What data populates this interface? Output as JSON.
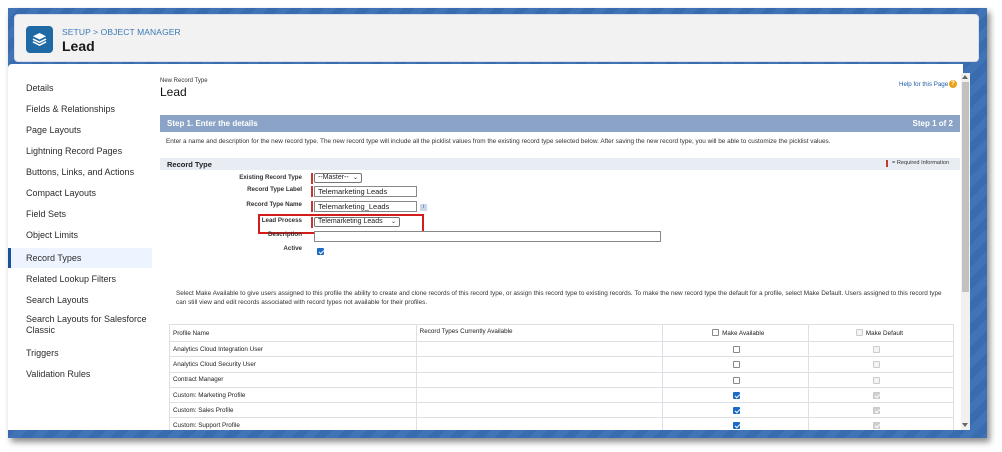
{
  "header": {
    "breadcrumb": "SETUP > OBJECT MANAGER",
    "title": "Lead",
    "icon": "layers-icon"
  },
  "sidebar": {
    "items": [
      {
        "label": "Details",
        "active": false
      },
      {
        "label": "Fields & Relationships",
        "active": false
      },
      {
        "label": "Page Layouts",
        "active": false
      },
      {
        "label": "Lightning Record Pages",
        "active": false
      },
      {
        "label": "Buttons, Links, and Actions",
        "active": false
      },
      {
        "label": "Compact Layouts",
        "active": false
      },
      {
        "label": "Field Sets",
        "active": false
      },
      {
        "label": "Object Limits",
        "active": false
      },
      {
        "label": "Record Types",
        "active": true
      },
      {
        "label": "Related Lookup Filters",
        "active": false
      },
      {
        "label": "Search Layouts",
        "active": false
      },
      {
        "label": "Search Layouts for Salesforce Classic",
        "active": false
      },
      {
        "label": "Triggers",
        "active": false
      },
      {
        "label": "Validation Rules",
        "active": false
      }
    ]
  },
  "page": {
    "subtitle": "New Record Type",
    "title": "Lead",
    "help_link": "Help for this Page",
    "step_title": "Step 1. Enter the details",
    "step_count": "Step 1 of 2",
    "intro": "Enter a name and description for the new record type. The new record type will include all the picklist values from the existing record type selected below. After saving the new record type, you will be able to customize the picklist values.",
    "section_title": "Record Type",
    "required_info": "= Required Information"
  },
  "form": {
    "existing_label": "Existing Record Type",
    "existing_value": "--Master--",
    "rt_label_label": "Record Type Label",
    "rt_label_value": "Telemarketing Leads",
    "rt_name_label": "Record Type Name",
    "rt_name_value": "Telemarketing_Leads",
    "info_icon": "i",
    "lead_process_label": "Lead Process",
    "lead_process_value": "Telemarketing Leads",
    "description_label": "Description",
    "description_value": "",
    "active_label": "Active",
    "active_checked": true
  },
  "profiles": {
    "intro": "Select Make Available to give users assigned to this profile the ability to create and clone records of this record type, or assign this record type to existing records. To make the new record type the default for a profile, select Make Default. Users assigned to this record type can still view and edit records associated with record types not available for their profiles.",
    "columns": [
      "Profile Name",
      "Record Types Currently Available",
      "Make Available",
      "Make Default"
    ],
    "rows": [
      {
        "name": "Analytics Cloud Integration User",
        "available": false,
        "default": false
      },
      {
        "name": "Analytics Cloud Security User",
        "available": false,
        "default": false
      },
      {
        "name": "Contract Manager",
        "available": false,
        "default": false
      },
      {
        "name": "Custom: Marketing Profile",
        "available": true,
        "default": true
      },
      {
        "name": "Custom: Sales Profile",
        "available": true,
        "default": true
      },
      {
        "name": "Custom: Support Profile",
        "available": true,
        "default": true
      }
    ]
  },
  "colors": {
    "brand": "#1f6aa5",
    "step_bar": "#8aa3c6",
    "highlight": "#d41c1c",
    "required": "#c23934"
  }
}
